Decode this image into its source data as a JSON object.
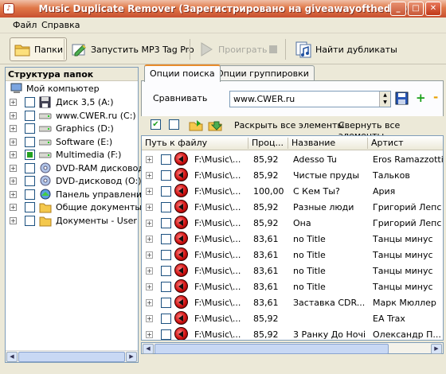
{
  "window": {
    "title": "Music Duplicate Remover (Зарегистрировано на giveawayoftheday)",
    "minimize": "_",
    "maximize": "□",
    "close": "✕"
  },
  "menu": [
    "Файл",
    "Справка"
  ],
  "toolbar": {
    "folders": "Папки",
    "tagpro": "Запустить MP3 Tag Pro",
    "play": "Проиграть",
    "find": "Найти дубликаты"
  },
  "left_panel": {
    "title": "Структура папок",
    "root": "Мой компьютер",
    "items": [
      {
        "label": "Диск 3,5 (A:)",
        "icon": "floppy-icon",
        "state": "none"
      },
      {
        "label": "www.CWER.ru (C:)",
        "icon": "drive-icon",
        "state": "none"
      },
      {
        "label": "Graphics (D:)",
        "icon": "drive-icon",
        "state": "none"
      },
      {
        "label": "Software (E:)",
        "icon": "drive-icon",
        "state": "none"
      },
      {
        "label": "Multimedia (F:)",
        "icon": "drive-icon",
        "state": "partial"
      },
      {
        "label": "DVD-RAM дисковод",
        "icon": "dvd-icon",
        "state": "none"
      },
      {
        "label": "DVD-дисковод (O:)",
        "icon": "dvd-icon",
        "state": "none"
      },
      {
        "label": "Панель управления",
        "icon": "control-panel-icon",
        "state": "none"
      },
      {
        "label": "Общие документы",
        "icon": "folder-icon",
        "state": "none"
      },
      {
        "label": "Документы - User",
        "icon": "folder-icon",
        "state": "none"
      }
    ]
  },
  "tabs": [
    "Опции поиска",
    "Опции группировки"
  ],
  "search": {
    "compare_label": "Сравнивать",
    "compare_value": "www.CWER.ru"
  },
  "toolbar2": {
    "expand_all": "Раскрыть все элементы",
    "collapse_all": "Свернуть все элементы"
  },
  "table": {
    "columns": [
      "Путь к файлу",
      "Проц...",
      "Название",
      "Артист"
    ],
    "rows": [
      [
        "F:\\Music\\...",
        "85,92",
        "Adesso Tu",
        "Eros Ramazzotti"
      ],
      [
        "F:\\Music\\...",
        "85,92",
        "Чистые пруды",
        "Тальков"
      ],
      [
        "F:\\Music\\...",
        "100,00",
        "С Кем Ты?",
        "Ария"
      ],
      [
        "F:\\Music\\...",
        "85,92",
        "Разные люди",
        "Григорий Лепс"
      ],
      [
        "F:\\Music\\...",
        "85,92",
        "Она",
        "Григорий Лепс"
      ],
      [
        "F:\\Music\\...",
        "83,61",
        "no Title",
        "Танцы минус"
      ],
      [
        "F:\\Music\\...",
        "83,61",
        "no Title",
        "Танцы минус"
      ],
      [
        "F:\\Music\\...",
        "83,61",
        "no Title",
        "Танцы минус"
      ],
      [
        "F:\\Music\\...",
        "83,61",
        "no Title",
        "Танцы минус"
      ],
      [
        "F:\\Music\\...",
        "83,61",
        "Заставка CDR...",
        "Марк Мюллер"
      ],
      [
        "F:\\Music\\...",
        "85,92",
        "",
        "EA Trax"
      ],
      [
        "F:\\Music\\...",
        "85,92",
        "3 Ранку До Ночі",
        "Олександр П..."
      ]
    ]
  }
}
